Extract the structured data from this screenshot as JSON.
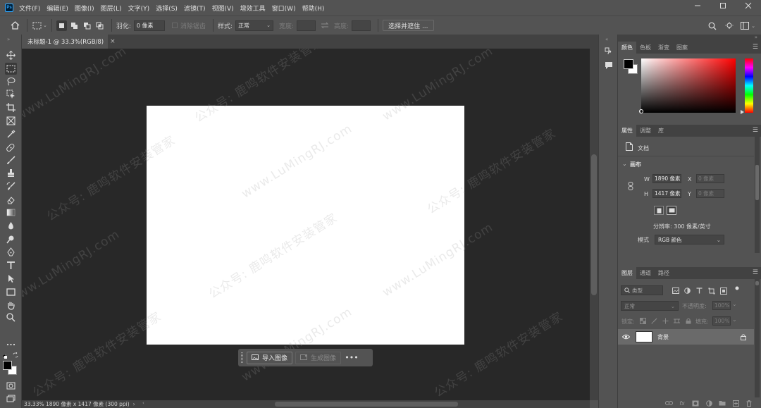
{
  "app": {
    "logo_text": "Ps",
    "menu": [
      "文件(F)",
      "编辑(E)",
      "图像(I)",
      "图层(L)",
      "文字(Y)",
      "选择(S)",
      "滤镜(T)",
      "视图(V)",
      "增效工具",
      "窗口(W)",
      "帮助(H)"
    ]
  },
  "options": {
    "feather_label": "羽化:",
    "feather_value": "0 像素",
    "antialias_label": "消除锯齿",
    "style_label": "样式:",
    "style_value": "正常",
    "width_label": "宽度:",
    "height_label": "高度:",
    "select_mask_label": "选择并遮住 ..."
  },
  "document": {
    "tab_title": "未标题-1 @ 33.3%(RGB/8)",
    "tab_close": "×"
  },
  "taskbar": {
    "import_label": "导入图像",
    "generate_label": "生成图像",
    "more_label": "•••"
  },
  "status": {
    "text": "33.33%  1890 像素 x 1417 像素 (300 ppi)",
    "arrow": "›"
  },
  "watermarks": {
    "url": "www.LuMingRJ.com",
    "wechat": "公众号: 鹿鸣软件安装管家"
  },
  "color_panel": {
    "tabs": [
      "颜色",
      "色板",
      "渐变",
      "图案"
    ],
    "foreground": "#000000",
    "background": "#ffffff"
  },
  "properties": {
    "tabs": [
      "属性",
      "调整",
      "库"
    ],
    "doc_label": "文档",
    "canvas_section": "画布",
    "w_label": "W",
    "w_value": "1890 像素",
    "h_label": "H",
    "h_value": "1417 像素",
    "x_label": "X",
    "x_placeholder": "0 像素",
    "y_label": "Y",
    "y_placeholder": "0 像素",
    "resolution": "分辨率: 300 像素/英寸",
    "mode_label": "模式",
    "mode_value": "RGB 颜色"
  },
  "layers": {
    "tabs": [
      "图层",
      "通道",
      "路径"
    ],
    "filter_label": "类型",
    "blend_mode": "正常",
    "opacity_label": "不透明度:",
    "opacity_value": "100%",
    "lock_label": "锁定:",
    "fill_label": "填充:",
    "fill_value": "100%",
    "items": [
      {
        "name": "背景"
      }
    ]
  }
}
